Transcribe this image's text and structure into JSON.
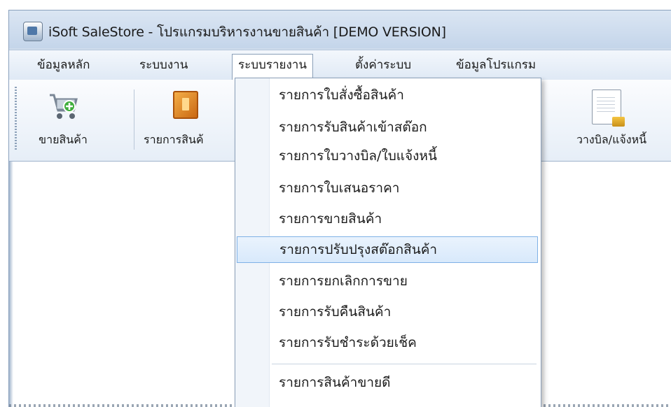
{
  "window": {
    "title": "iSoft SaleStore - โปรแกรมบริหารงานขายสินค้า [DEMO VERSION]"
  },
  "menubar": {
    "items": [
      {
        "label": "ข้อมูลหลัก"
      },
      {
        "label": "ระบบงาน"
      },
      {
        "label": "ระบบรายงาน"
      },
      {
        "label": "ตั้งค่าระบบ"
      },
      {
        "label": "ข้อมูลโปรแกรม"
      }
    ],
    "open_menu": "ระบบรายงาน"
  },
  "toolbar": {
    "buttons": [
      {
        "label": "ขายสินค้า",
        "icon": "shopping-cart-add-icon"
      },
      {
        "label": "รายการสินค้",
        "icon": "product-box-icon"
      },
      {
        "label": "วางบิล/แจ้งหนี้",
        "icon": "invoice-document-icon"
      }
    ]
  },
  "report_menu": {
    "items": [
      {
        "label": "รายการใบสั่งซื้อสินค้า"
      },
      {
        "label": "รายการรับสินค้าเข้าสต๊อก"
      },
      {
        "label": "รายการใบวางบิล/ใบแจ้งหนี้"
      },
      {
        "label": "รายการใบเสนอราคา"
      },
      {
        "label": "รายการขายสินค้า"
      },
      {
        "label": "รายการปรับปรุงสต๊อกสินค้า"
      },
      {
        "label": "รายการยกเลิกการขาย"
      },
      {
        "label": "รายการรับคืนสินค้า"
      },
      {
        "label": "รายการรับชำระด้วยเช็ค"
      },
      {
        "label": "รายการสินค้าขายดี"
      }
    ],
    "highlighted": "รายการปรับปรุงสต๊อกสินค้า"
  },
  "colors": {
    "highlight_border": "#7fb1e6",
    "highlight_fill": "#d8e9fb",
    "menubar_bg": "#dfe9f5"
  }
}
